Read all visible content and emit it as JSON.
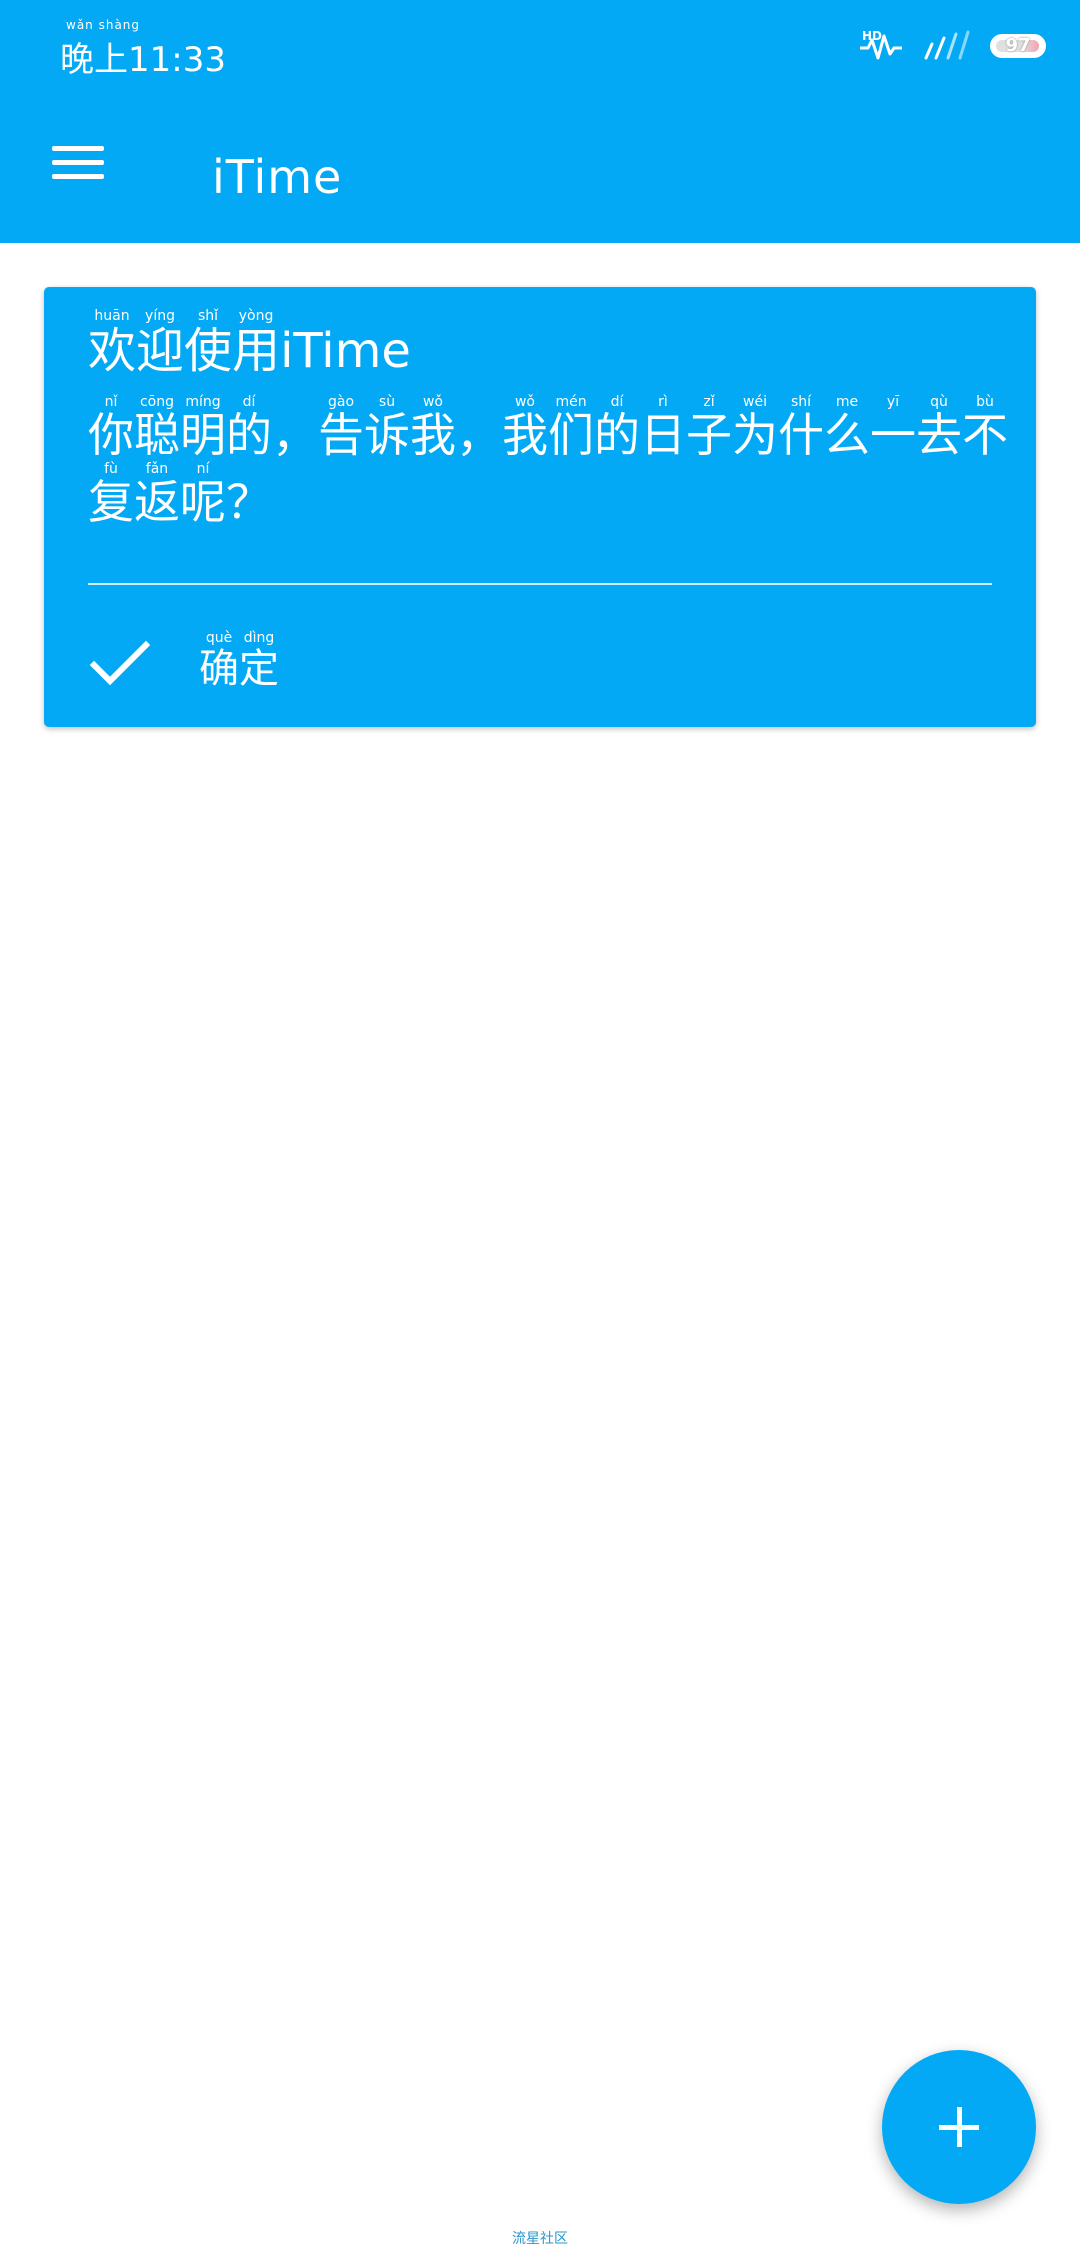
{
  "status_bar": {
    "time": "晚上11:33",
    "time_pinyin": "wǎn shàng",
    "battery_level": "97",
    "network_label": "HD"
  },
  "app_bar": {
    "title": "iTime"
  },
  "welcome_card": {
    "title_chars": [
      {
        "char": "欢",
        "pinyin": "huān"
      },
      {
        "char": "迎",
        "pinyin": "yíng"
      },
      {
        "char": "使",
        "pinyin": "shǐ"
      },
      {
        "char": "用",
        "pinyin": "yòng"
      }
    ],
    "title_suffix": "iTime",
    "body_chars": [
      {
        "char": "你",
        "pinyin": "nǐ"
      },
      {
        "char": "聪",
        "pinyin": "cōng"
      },
      {
        "char": "明",
        "pinyin": "míng"
      },
      {
        "char": "的",
        "pinyin": "dí"
      },
      {
        "char": "，",
        "pinyin": ""
      },
      {
        "char": "告",
        "pinyin": "gào"
      },
      {
        "char": "诉",
        "pinyin": "sù"
      },
      {
        "char": "我",
        "pinyin": "wǒ"
      },
      {
        "char": "，",
        "pinyin": ""
      },
      {
        "char": "我",
        "pinyin": "wǒ"
      },
      {
        "char": "们",
        "pinyin": "mén"
      },
      {
        "char": "的",
        "pinyin": "dí"
      },
      {
        "char": "日",
        "pinyin": "rì"
      },
      {
        "char": "子",
        "pinyin": "zǐ"
      },
      {
        "char": "为",
        "pinyin": "wéi"
      },
      {
        "char": "什",
        "pinyin": "shí"
      },
      {
        "char": "么",
        "pinyin": "me"
      },
      {
        "char": "一",
        "pinyin": "yī"
      },
      {
        "char": "去",
        "pinyin": "qù"
      },
      {
        "char": "不",
        "pinyin": "bù"
      },
      {
        "char": "复",
        "pinyin": "fù"
      },
      {
        "char": "返",
        "pinyin": "fǎn"
      },
      {
        "char": "呢",
        "pinyin": "ní"
      },
      {
        "char": "？",
        "pinyin": ""
      }
    ],
    "confirm_chars": [
      {
        "char": "确",
        "pinyin": "què"
      },
      {
        "char": "定",
        "pinyin": "dìng"
      }
    ]
  },
  "footer": {
    "watermark": "流星社区"
  },
  "colors": {
    "primary": "#03A9F4",
    "on_primary": "#FFFFFF",
    "background": "#FFFFFF"
  }
}
